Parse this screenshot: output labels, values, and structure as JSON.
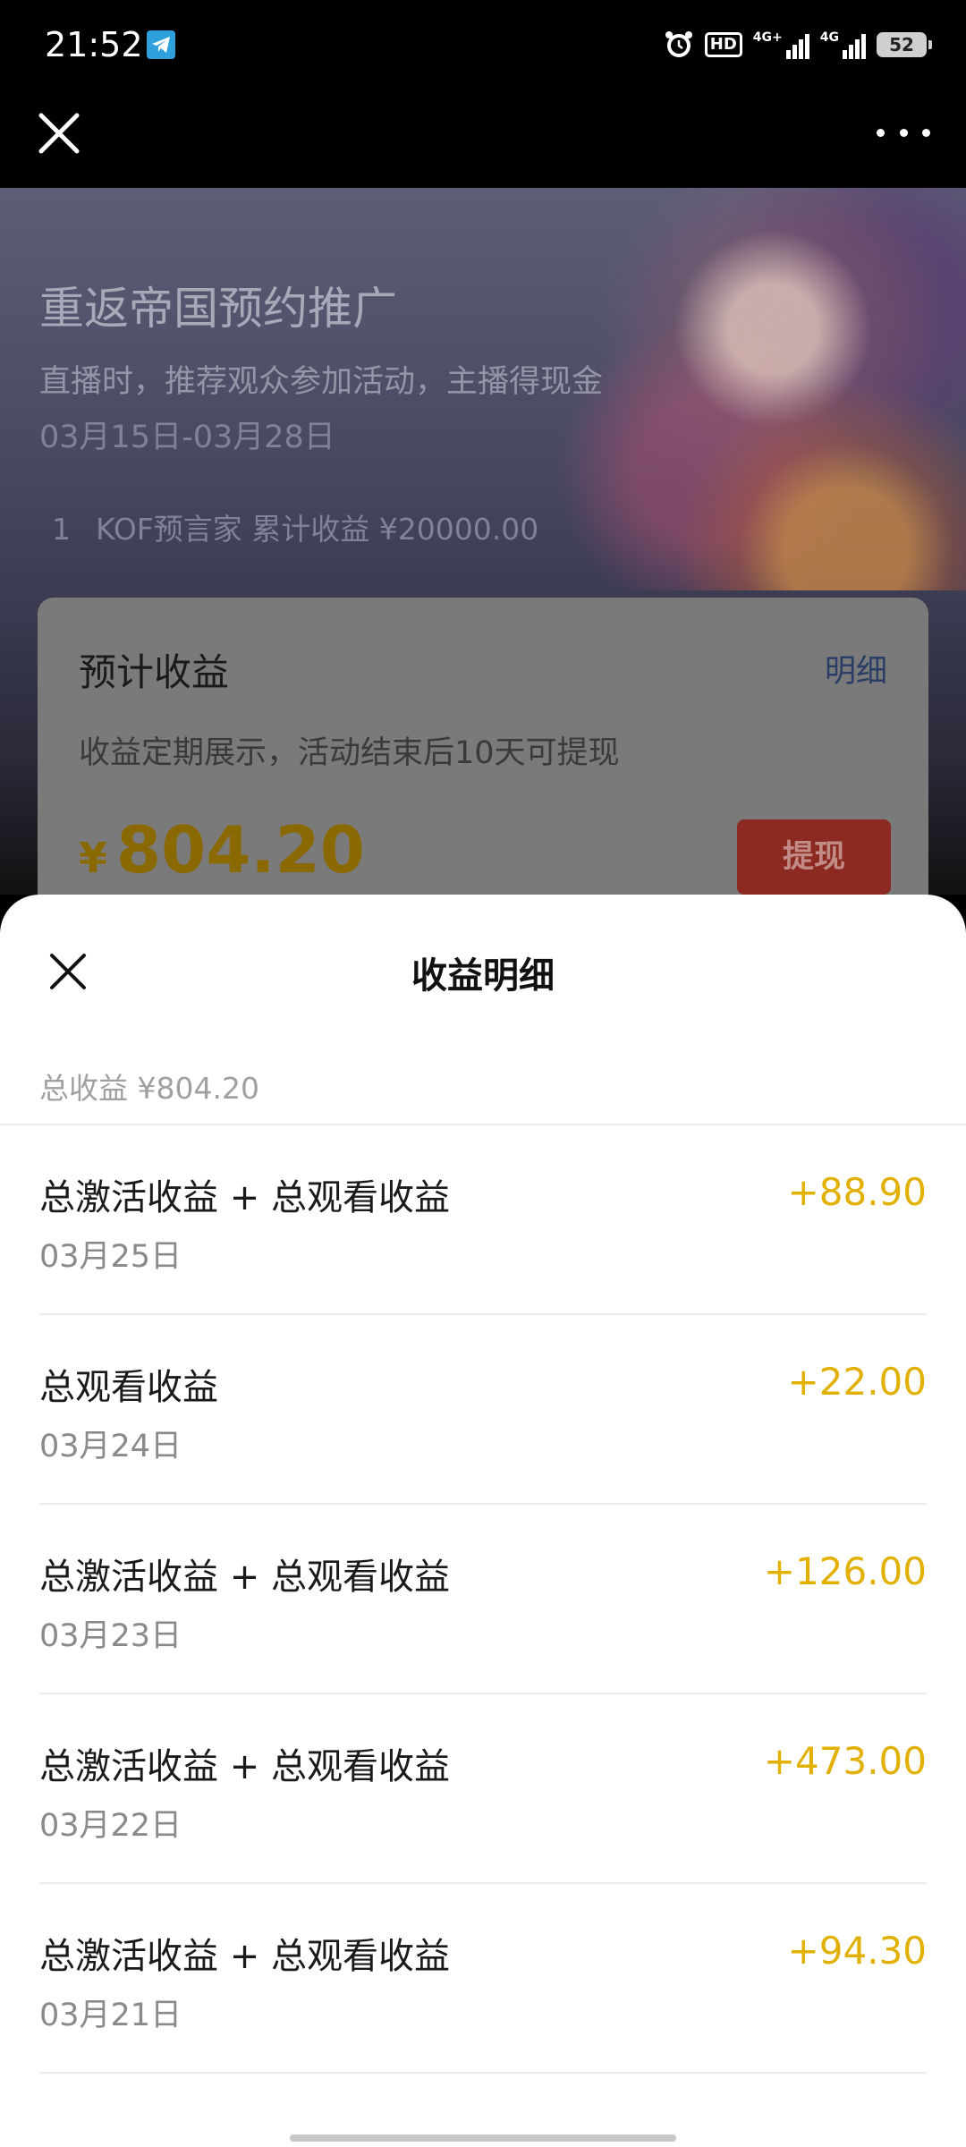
{
  "status_bar": {
    "time": "21:52",
    "hd_label": "HD",
    "net1": "4G+",
    "net2": "4G",
    "battery": "52"
  },
  "nav": {
    "close_icon": "close-icon",
    "more_icon": "more-icon"
  },
  "background_page": {
    "title": "重返帝国预约推广",
    "subtitle": "直播时，推荐观众参加活动，主播得现金",
    "date_range": "03月15日-03月28日",
    "rank": {
      "index": "1",
      "text": "KOF预言家 累计收益 ¥20000.00"
    },
    "estimate_card": {
      "title": "预计收益",
      "detail_link": "明细",
      "note": "收益定期展示，活动结束后10天可提现",
      "currency": "¥",
      "amount": "804.20",
      "withdraw_label": "提现"
    }
  },
  "sheet": {
    "title": "收益明细",
    "total": "总收益 ¥804.20",
    "items": [
      {
        "title": "总激活收益 + 总观看收益",
        "date": "03月25日",
        "amount": "+88.90"
      },
      {
        "title": "总观看收益",
        "date": "03月24日",
        "amount": "+22.00"
      },
      {
        "title": "总激活收益 + 总观看收益",
        "date": "03月23日",
        "amount": "+126.00"
      },
      {
        "title": "总激活收益 + 总观看收益",
        "date": "03月22日",
        "amount": "+473.00"
      },
      {
        "title": "总激活收益 + 总观看收益",
        "date": "03月21日",
        "amount": "+94.30"
      }
    ]
  },
  "colors": {
    "amount": "#e2b000",
    "withdraw_button": "#8c2a22",
    "link": "#2a3d66"
  }
}
